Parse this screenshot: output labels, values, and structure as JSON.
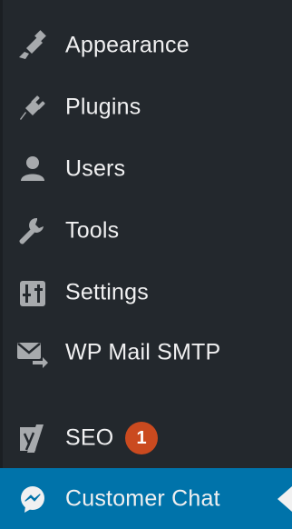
{
  "menu": {
    "items": [
      {
        "label": "Appearance",
        "icon": "paintbrush-icon"
      },
      {
        "label": "Plugins",
        "icon": "plug-icon"
      },
      {
        "label": "Users",
        "icon": "user-icon"
      },
      {
        "label": "Tools",
        "icon": "wrench-icon"
      },
      {
        "label": "Settings",
        "icon": "settings-sliders-icon"
      },
      {
        "label": "WP Mail SMTP",
        "icon": "mail-arrow-icon"
      },
      {
        "label": "SEO",
        "icon": "yoast-y-icon",
        "badge": "1"
      },
      {
        "label": "Customer Chat",
        "icon": "messenger-icon",
        "active": true
      }
    ]
  },
  "colors": {
    "background": "#23282d",
    "text": "#f0f0f1",
    "icon": "#a7aaad",
    "active_background": "#0073aa",
    "badge_background": "#ca4a1f",
    "active_arrow": "#f1f1f1"
  }
}
